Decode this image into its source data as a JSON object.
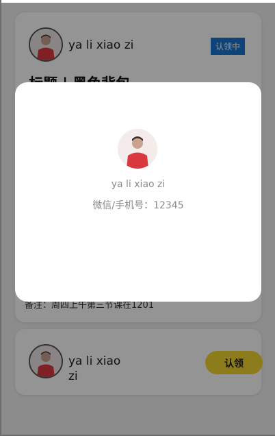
{
  "cards": [
    {
      "username": "ya li xiao zi",
      "status_badge": "认领中",
      "title": "标题 | 黑色背包",
      "note": "备注：周四上午第三节课在1201"
    },
    {
      "username": "ya li xiao zi",
      "claim_button": "认领"
    }
  ],
  "modal": {
    "name": "ya li xiao zi",
    "contact_label": "微信/手机号：",
    "contact_value": "12345"
  },
  "colors": {
    "badge_blue": "#1976d2",
    "claim_yellow": "#f2d631",
    "overlay": "rgba(0,0,0,0.42)"
  },
  "icons": {
    "avatar": "user-avatar-photo"
  }
}
